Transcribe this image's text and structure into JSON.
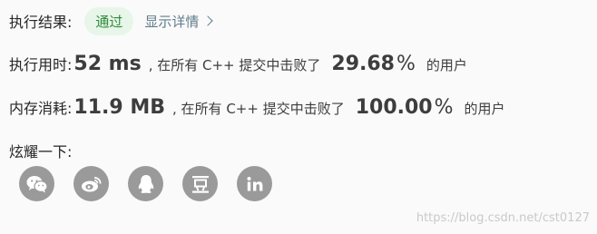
{
  "result": {
    "label": "执行结果:",
    "status": "通过",
    "detail_link": "显示详情"
  },
  "time": {
    "label": "执行用时:",
    "value": "52 ms",
    "beat_prefix": ", 在所有 C++ 提交中击败了",
    "percent": "29.68",
    "percent_sign": "%",
    "suffix": "的用户"
  },
  "memory": {
    "label": "内存消耗:",
    "value": "11.9 MB",
    "beat_prefix": ", 在所有 C++ 提交中击败了",
    "percent": "100.00",
    "percent_sign": "%",
    "suffix": "的用户"
  },
  "share": {
    "label": "炫耀一下:",
    "icons": [
      "wechat-icon",
      "weibo-icon",
      "qq-icon",
      "douban-icon",
      "linkedin-icon"
    ]
  },
  "watermark": "https://blog.csdn.net/cst0127",
  "colors": {
    "background": "#fafafa",
    "badge_bg": "#e7f6e9",
    "badge_text": "#2f8a3a",
    "link": "#607d8b",
    "icon_bg": "#9a9a9a"
  }
}
